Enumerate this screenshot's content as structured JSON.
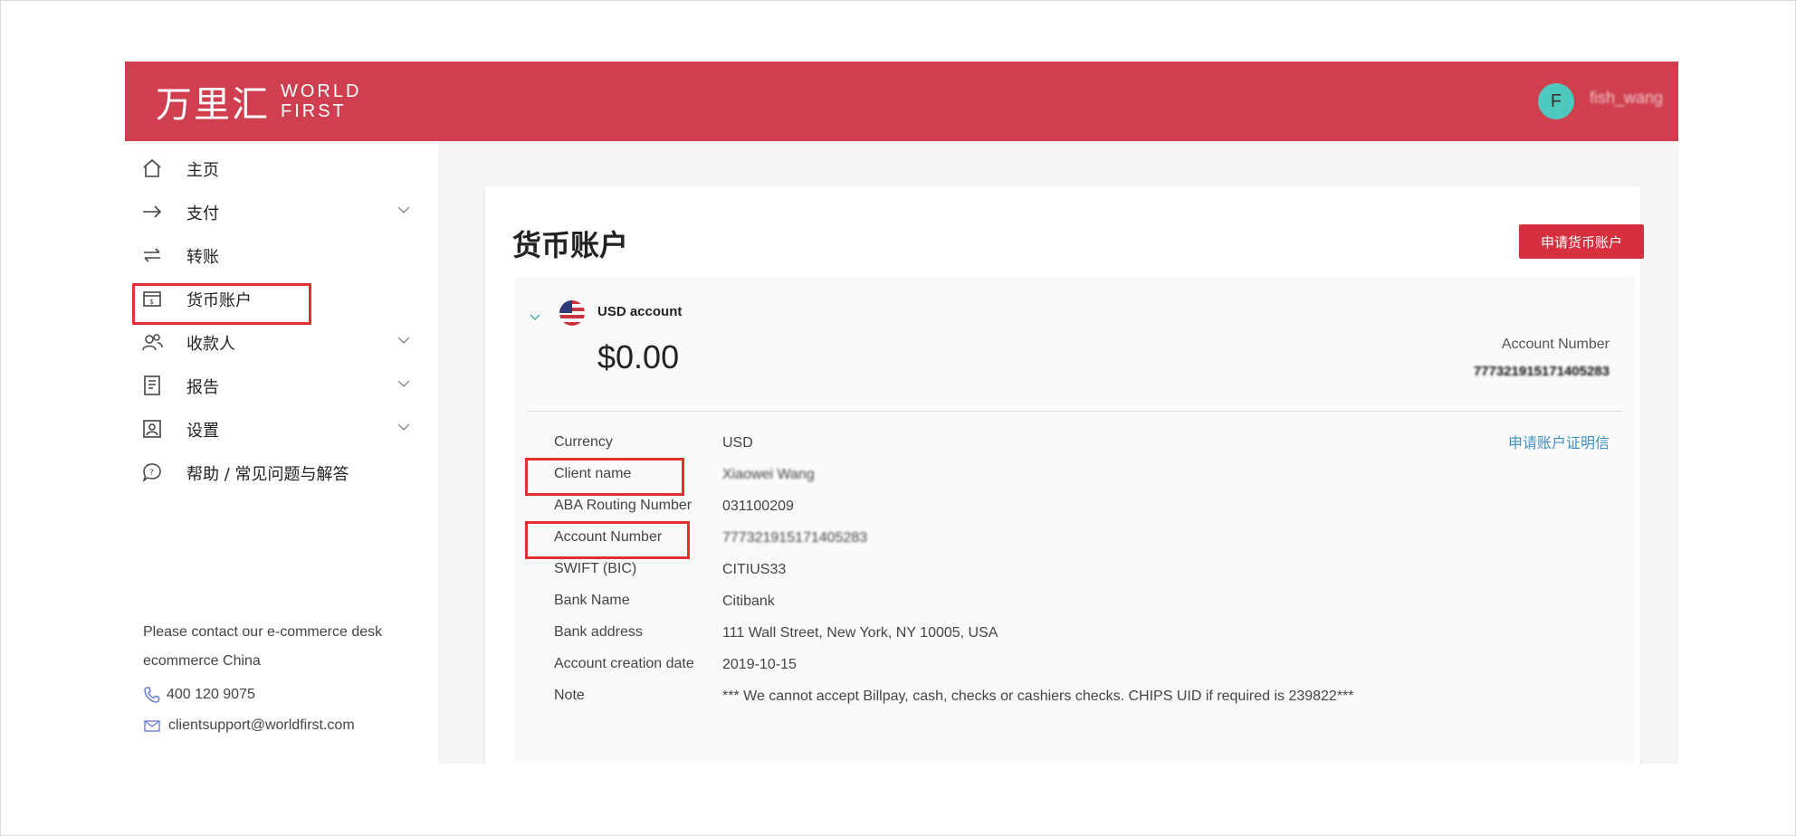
{
  "header": {
    "logo_cn": "万里汇",
    "logo_en_line1": "WORLD",
    "logo_en_line2": "FIRST",
    "avatar_initial": "F",
    "username": "fish_wang"
  },
  "sidebar": {
    "items": [
      {
        "label": "主页",
        "icon": "home-icon"
      },
      {
        "label": "支付",
        "icon": "arrow-right-icon",
        "expandable": true
      },
      {
        "label": "转账",
        "icon": "transfer-icon"
      },
      {
        "label": "货币账户",
        "icon": "wallet-icon",
        "highlighted": true
      },
      {
        "label": "收款人",
        "icon": "users-icon",
        "expandable": true
      },
      {
        "label": "报告",
        "icon": "report-icon",
        "expandable": true
      },
      {
        "label": "设置",
        "icon": "settings-icon",
        "expandable": true
      },
      {
        "label": "帮助 / 常见问题与解答",
        "icon": "help-icon"
      }
    ],
    "contact_line1": "Please contact our e-commerce desk",
    "contact_line2": "ecommerce China",
    "phone": "400 120 9075",
    "email": "clientsupport@worldfirst.com"
  },
  "main": {
    "title": "货币账户",
    "apply_button": "申请货币账户",
    "account": {
      "name": "USD account",
      "balance": "$0.00",
      "account_number_label": "Account Number",
      "account_number_value": "777321915171405283",
      "certificate_link": "申请账户证明信",
      "details": [
        {
          "label": "Currency",
          "value": "USD"
        },
        {
          "label": "Client name",
          "value": "Xiaowei Wang",
          "highlight": true
        },
        {
          "label": "ABA Routing Number",
          "value": "031100209"
        },
        {
          "label": "Account Number",
          "value": "777321915171405283",
          "highlight": true
        },
        {
          "label": "SWIFT (BIC)",
          "value": "CITIUS33"
        },
        {
          "label": "Bank Name",
          "value": "Citibank"
        },
        {
          "label": "Bank address",
          "value": "111 Wall Street, New York, NY 10005, USA"
        },
        {
          "label": "Account creation date",
          "value": "2019-10-15"
        },
        {
          "label": "Note",
          "value": "*** We cannot accept Billpay, cash, checks or cashiers checks. CHIPS UID if required is 239822***"
        }
      ]
    }
  },
  "colors": {
    "brand": "#cf3f4f",
    "button": "#d6303f",
    "link": "#3f8fbf",
    "highlight_box": "#e0312e",
    "avatar": "#4fc8be"
  }
}
